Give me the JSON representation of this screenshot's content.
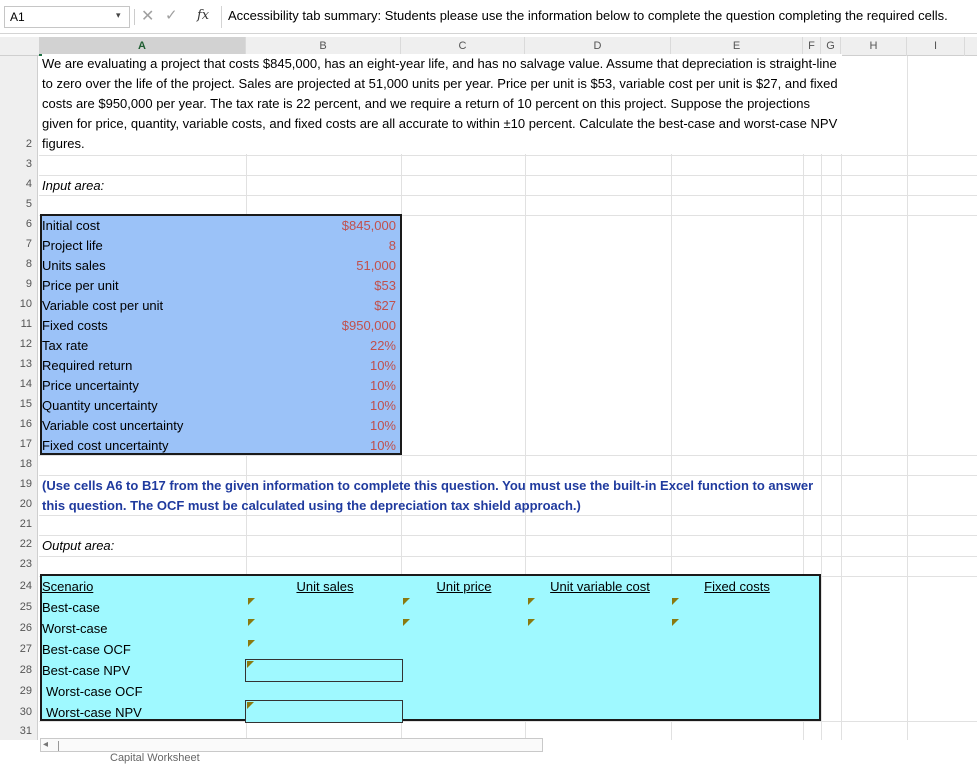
{
  "formula_bar": {
    "name_box": "A1",
    "dropdown_glyph": "▾",
    "cancel_glyph": "✕",
    "enter_glyph": "✓",
    "fx_label": "fx",
    "content": "Accessibility tab summary: Students please use the information below to complete the question completing the required cells."
  },
  "columns": [
    "A",
    "B",
    "C",
    "D",
    "E",
    "F",
    "G",
    "H",
    "I"
  ],
  "rows": [
    "2",
    "3",
    "4",
    "5",
    "6",
    "7",
    "8",
    "9",
    "10",
    "11",
    "12",
    "13",
    "14",
    "15",
    "16",
    "17",
    "18",
    "19",
    "20",
    "21",
    "22",
    "23",
    "24",
    "25",
    "26",
    "27",
    "28",
    "29",
    "30",
    "31"
  ],
  "problem_text": "We are evaluating a project that costs $845,000, has an eight-year life, and has no salvage value. Assume that depreciation is straight-line to zero over the life of the project. Sales are projected at 51,000 units per year. Price per unit is $53, variable cost per unit is $27, and fixed costs are $950,000 per year. The tax rate is 22 percent, and we require a return of 10 percent on this project. Suppose the projections given for price, quantity, variable costs, and fixed costs are all accurate to within ±10 percent. Calculate the best-case and worst-case NPV figures.",
  "input_area": {
    "label": "Input area:",
    "items": [
      {
        "label": "Initial cost",
        "value": "$845,000"
      },
      {
        "label": "Project life",
        "value": "8"
      },
      {
        "label": "Units sales",
        "value": "51,000"
      },
      {
        "label": "Price per unit",
        "value": "$53"
      },
      {
        "label": "Variable cost per unit",
        "value": "$27"
      },
      {
        "label": "Fixed costs",
        "value": "$950,000"
      },
      {
        "label": "Tax rate",
        "value": "22%"
      },
      {
        "label": "Required return",
        "value": "10%"
      },
      {
        "label": "Price uncertainty",
        "value": "10%"
      },
      {
        "label": "Quantity uncertainty",
        "value": "10%"
      },
      {
        "label": "Variable cost uncertainty",
        "value": "10%"
      },
      {
        "label": "Fixed cost uncertainty",
        "value": "10%"
      }
    ]
  },
  "instruction": "(Use cells A6 to B17 from the given information to complete this question. You must use the built-in Excel function to answer this question. The OCF must be calculated using the depreciation tax shield approach.)",
  "output_area": {
    "label": "Output area:",
    "headers": {
      "scenario": "Scenario",
      "unit_sales": "Unit sales",
      "unit_price": "Unit price",
      "unit_variable_cost": "Unit variable cost",
      "fixed_costs": "Fixed costs"
    },
    "rows": [
      "Best-case",
      "Worst-case",
      "Best-case OCF",
      "Best-case NPV",
      "Worst-case OCF",
      "Worst-case NPV"
    ]
  },
  "sheet_tab": "Capital Worksheet",
  "scroll_left_glyph": "◂",
  "colors": {
    "input_fill": "#9bc2f8",
    "output_fill": "#9ff9ff",
    "value_text": "#c0504d",
    "instruction_text": "#1f3a9e"
  }
}
